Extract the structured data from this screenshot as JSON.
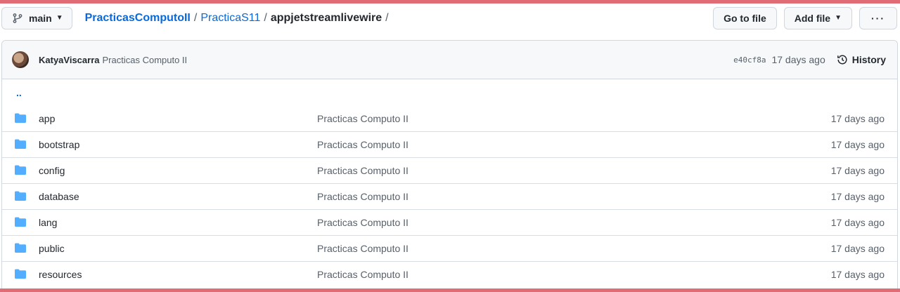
{
  "colors": {
    "accent": "#e06c75",
    "link": "#0969da",
    "folder": "#54aeff"
  },
  "toolbar": {
    "branch_label": "main",
    "breadcrumb": {
      "repo": "PracticasComputoII",
      "folder": "PracticaS11",
      "current": "appjetstreamlivewire",
      "separator": "/"
    },
    "go_to_file_label": "Go to file",
    "add_file_label": "Add file",
    "more_label": "···"
  },
  "commit": {
    "author": "KatyaViscarra",
    "message": "Practicas Computo II",
    "sha": "e40cf8a",
    "age": "17 days ago",
    "history_label": "History"
  },
  "parent_link": "..",
  "files": [
    {
      "name": "app",
      "message": "Practicas Computo II",
      "age": "17 days ago",
      "icon": "folder-icon"
    },
    {
      "name": "bootstrap",
      "message": "Practicas Computo II",
      "age": "17 days ago",
      "icon": "folder-icon"
    },
    {
      "name": "config",
      "message": "Practicas Computo II",
      "age": "17 days ago",
      "icon": "folder-icon"
    },
    {
      "name": "database",
      "message": "Practicas Computo II",
      "age": "17 days ago",
      "icon": "folder-icon"
    },
    {
      "name": "lang",
      "message": "Practicas Computo II",
      "age": "17 days ago",
      "icon": "folder-icon"
    },
    {
      "name": "public",
      "message": "Practicas Computo II",
      "age": "17 days ago",
      "icon": "folder-icon"
    },
    {
      "name": "resources",
      "message": "Practicas Computo II",
      "age": "17 days ago",
      "icon": "folder-icon"
    }
  ]
}
